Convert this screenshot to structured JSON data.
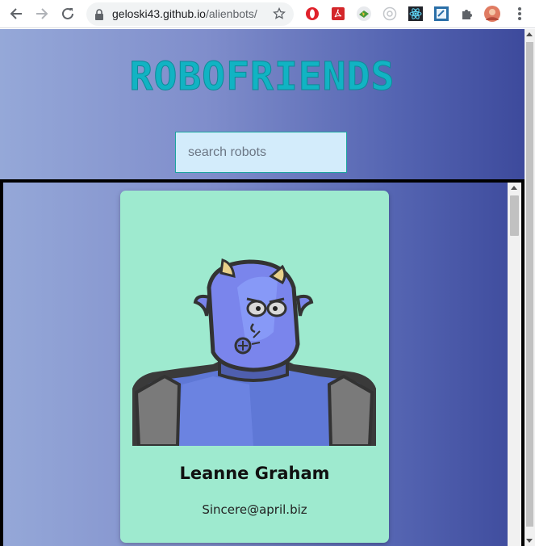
{
  "browser": {
    "url_host": "geloski43.github.io",
    "url_path": "/alienbots/",
    "icons": [
      "back-icon",
      "forward-icon",
      "reload-icon",
      "lock-icon",
      "bookmark-star-icon",
      "opera-icon",
      "pdf-icon",
      "extension-icon",
      "extension-icon",
      "react-devtools-icon",
      "extension-icon",
      "puzzle-icon",
      "profile-avatar-icon",
      "menu-dots-icon"
    ]
  },
  "page": {
    "logo_text": "ROBOFRIENDS",
    "search_placeholder": "search robots",
    "accent_color": "#11b3c3"
  },
  "robots": [
    {
      "name": "Leanne Graham",
      "email": "Sincere@april.biz",
      "avatar": "robot-avatar-icon"
    }
  ]
}
